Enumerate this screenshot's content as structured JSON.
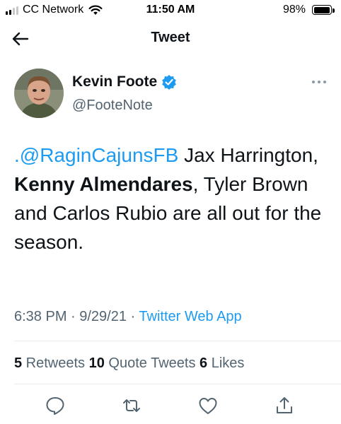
{
  "status_bar": {
    "carrier": "CC Network",
    "time": "11:50 AM",
    "battery": "98%",
    "battery_level": 0.98,
    "signal_bars": 2
  },
  "header": {
    "title": "Tweet",
    "back_icon": "arrow-left-icon"
  },
  "tweet": {
    "author": {
      "name": "Kevin Foote",
      "handle": "@FooteNote",
      "verified": true
    },
    "text": {
      "mention": ".@RaginCajunsFB",
      "part1": " Jax Harrington, ",
      "bold1": "Kenny Almendares",
      "part2": ", Tyler Brown and Carlos Rubio are all out for the season."
    },
    "timestamp": "6:38 PM · 9/29/21 · ",
    "source": "Twitter Web App",
    "stats": {
      "retweets_count": "5",
      "retweets_label": " Retweets ",
      "quotes_count": "10",
      "quotes_label": " Quote Tweets ",
      "likes_count": "6",
      "likes_label": " Likes"
    }
  },
  "colors": {
    "accent": "#1d9bf0",
    "text": "#0f1419",
    "secondary": "#536471",
    "divider": "#e6ecf0"
  },
  "actions": [
    "reply-icon",
    "retweet-icon",
    "like-icon",
    "share-icon"
  ]
}
